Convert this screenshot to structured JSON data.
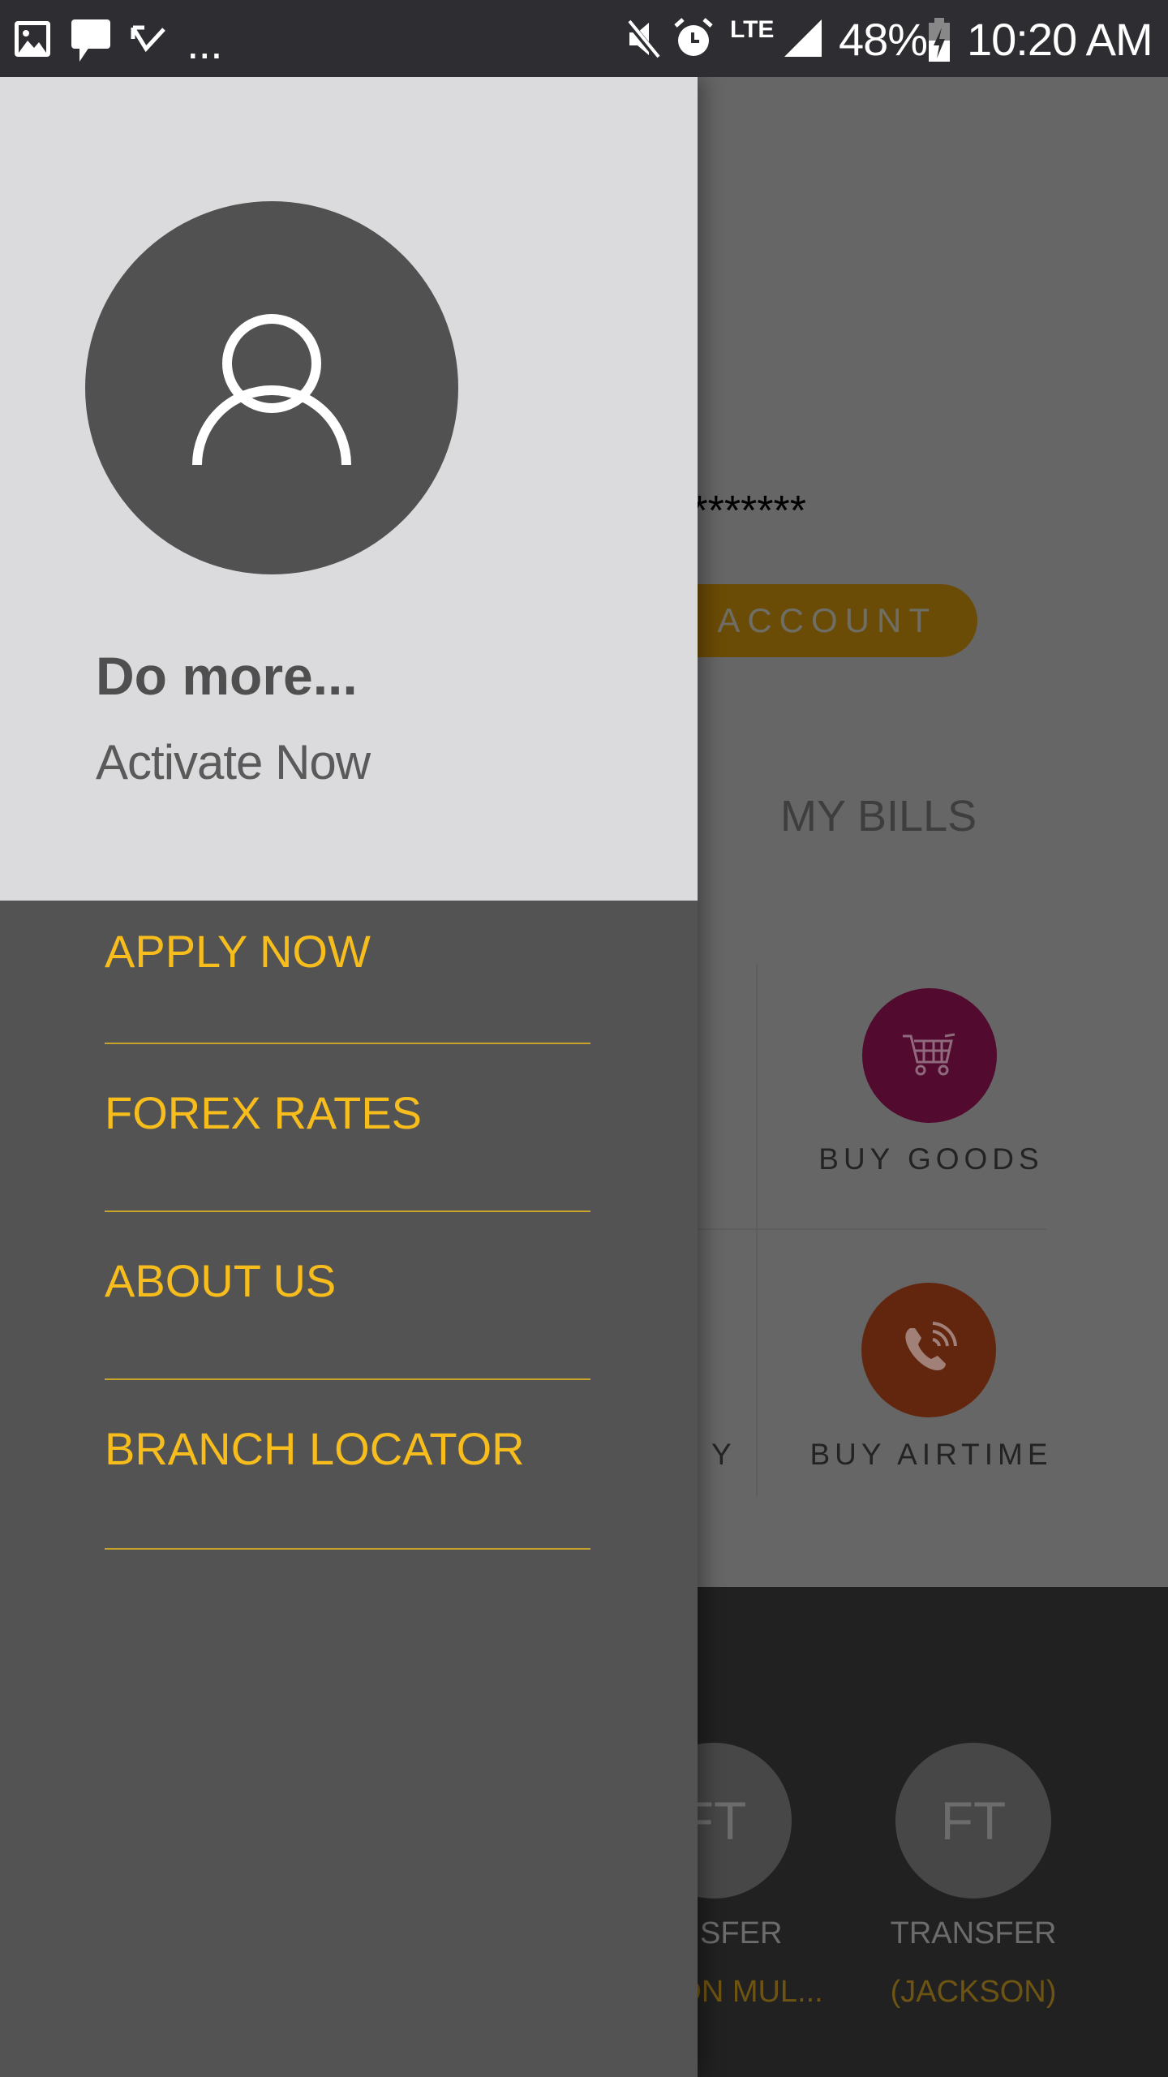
{
  "status_bar": {
    "left_icons": [
      "gallery-icon",
      "message-icon",
      "missed-call-icon",
      "more-icon"
    ],
    "more": "...",
    "right_icons": [
      "mute-icon",
      "alarm-icon",
      "lte-icon",
      "signal-icon",
      "battery-charging-icon"
    ],
    "lte": "LTE",
    "battery": "48%",
    "time": "10:20 AM"
  },
  "background": {
    "masked_account": "*******",
    "account_button": "K ACCOUNT",
    "section_title": "MY BILLS",
    "tiles": [
      {
        "label": "Y"
      },
      {
        "label": "BUY GOODS",
        "icon": "shopping-cart-icon",
        "color": "#520a2e"
      },
      {
        "label": "BUY AIRTIME",
        "icon": "phone-call-icon",
        "color": "#62260f"
      }
    ],
    "favorites": [
      {
        "initials": "FT",
        "title": "NSFER",
        "name": "ON MUL..."
      },
      {
        "initials": "FT",
        "title": "TRANSFER",
        "name": "(JACKSON)"
      }
    ]
  },
  "drawer": {
    "avatar_icon": "user-icon",
    "title": "Do more...",
    "subtitle": "Activate Now",
    "accent": "#f6bd1d",
    "items": [
      {
        "label": "APPLY NOW"
      },
      {
        "label": "FOREX RATES"
      },
      {
        "label": "ABOUT US"
      },
      {
        "label": "BRANCH LOCATOR"
      }
    ]
  }
}
